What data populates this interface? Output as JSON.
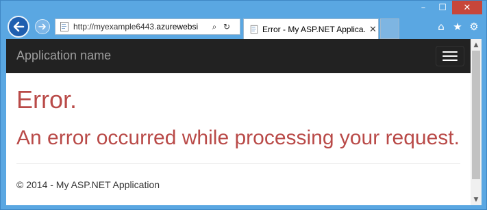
{
  "browser": {
    "caption": {
      "minimize_icon": "–",
      "maximize_icon": "☐",
      "close_icon": "✕"
    },
    "address": {
      "url_prefix": "http://myexample6443.",
      "url_host": "azurewebsi",
      "search_icon": "⌕",
      "refresh_icon": "↻"
    },
    "tab": {
      "title": "Error - My ASP.NET Applica...",
      "close_icon": "✕"
    },
    "toolbar": {
      "home_icon": "⌂",
      "favorites_icon": "★",
      "tools_icon": "⚙"
    }
  },
  "page": {
    "navbar": {
      "brand": "Application name"
    },
    "error_title": "Error.",
    "error_message": "An error occurred while processing your request.",
    "footer": "© 2014 - My ASP.NET Application"
  },
  "colors": {
    "frame": "#5aa7e2",
    "navbar": "#222222",
    "error_text": "#b94a48",
    "close_button": "#c7463a"
  }
}
